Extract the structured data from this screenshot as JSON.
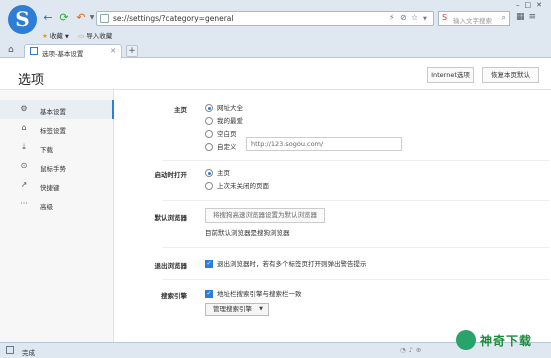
{
  "browser": {
    "address_url": "se://settings/?category=general",
    "search_placeholder": "输入文字搜索",
    "favorites_label": "收藏",
    "import_favorites_label": "导入收藏",
    "tab_label": "选项-基本设置",
    "new_tab_symbol": "+"
  },
  "page": {
    "title": "选项",
    "internet_options_button": "Internet选项",
    "restore_defaults_button": "恢复本页默认"
  },
  "sidebar": {
    "items": [
      {
        "label": "基本设置",
        "icon": "gear-icon",
        "glyph": "⚙",
        "active": true
      },
      {
        "label": "标签设置",
        "icon": "tab-icon",
        "glyph": "⌂",
        "active": false
      },
      {
        "label": "下载",
        "icon": "download-icon",
        "glyph": "⤓",
        "active": false
      },
      {
        "label": "鼠标手势",
        "icon": "mouse-icon",
        "glyph": "⊙",
        "active": false
      },
      {
        "label": "快捷键",
        "icon": "shortcut-icon",
        "glyph": "↗",
        "active": false
      },
      {
        "label": "高级",
        "icon": "more-icon",
        "glyph": "···",
        "active": false
      }
    ]
  },
  "settings": {
    "homepage": {
      "label": "主页",
      "options": [
        "网址大全",
        "我的最爱",
        "空白页",
        "自定义"
      ],
      "selected_index": 0,
      "custom_url": "http://123.sogou.com/"
    },
    "startup": {
      "label": "启动时打开",
      "options": [
        "主页",
        "上次未关闭的页面"
      ],
      "selected_index": 0
    },
    "default_browser": {
      "label": "默认浏览器",
      "button": "将搜狗高速浏览器设置为默认浏览器",
      "status": "目前默认浏览器是搜狗浏览器"
    },
    "exit_browser": {
      "label": "退出浏览器",
      "checkbox": "退出浏览器时，若有多个标签页打开则弹出警告提示",
      "checked": true
    },
    "search_engine": {
      "label": "搜索引擎",
      "checkbox": "地址栏搜索引擎与搜索栏一致",
      "checked": true,
      "manage_label": "管理搜索引擎"
    }
  },
  "status_bar": {
    "text": "完成"
  },
  "watermark": {
    "text": "神奇下载"
  }
}
